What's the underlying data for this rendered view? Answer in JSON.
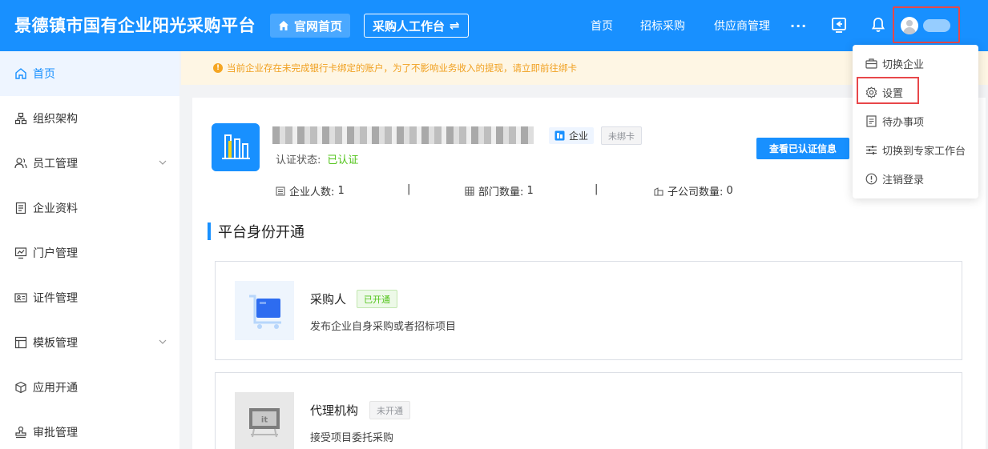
{
  "header": {
    "brand": "景德镇市国有企业阳光采购平台",
    "home_button": "官网首页",
    "workbench_button": "采购人工作台",
    "workbench_swap_glyph": "⇌",
    "nav": {
      "home": "首页",
      "bidding": "招标采购",
      "supplier": "供应商管理",
      "more": "···"
    },
    "icons": [
      "exit-icon",
      "bell-icon",
      "avatar"
    ],
    "colors": {
      "primary": "#1890ff",
      "highlight": "#e8474a"
    }
  },
  "sidebar": {
    "items": [
      {
        "label": "首页",
        "icon": "home-icon",
        "active": true
      },
      {
        "label": "组织架构",
        "icon": "org-chart-icon"
      },
      {
        "label": "员工管理",
        "icon": "users-icon",
        "expandable": true
      },
      {
        "label": "企业资料",
        "icon": "document-icon"
      },
      {
        "label": "门户管理",
        "icon": "monitor-icon"
      },
      {
        "label": "证件管理",
        "icon": "id-card-icon"
      },
      {
        "label": "模板管理",
        "icon": "template-icon",
        "expandable": true
      },
      {
        "label": "应用开通",
        "icon": "cube-icon"
      },
      {
        "label": "审批管理",
        "icon": "stamp-icon"
      }
    ]
  },
  "alert": {
    "text": "当前企业存在未完成银行卡绑定的账户，为了不影响业务收入的提现，请立即前往绑卡",
    "color": "#f0a020"
  },
  "company": {
    "type_tag": "企业",
    "card_tag": "未绑卡",
    "cert_label": "认证状态:",
    "cert_value": "已认证",
    "view_cert_button": "查看已认证信息",
    "stats": {
      "employees_label": "企业人数:",
      "employees_value": "1",
      "departments_label": "部门数量:",
      "departments_value": "1",
      "subsidiaries_label": "子公司数量:",
      "subsidiaries_value": "0",
      "separator": "|"
    }
  },
  "section": {
    "title": "平台身份开通"
  },
  "identities": [
    {
      "name": "采购人",
      "status": "已开通",
      "desc": "发布企业自身采购或者招标项目"
    },
    {
      "name": "代理机构",
      "status": "未开通",
      "desc": "接受项目委托采购"
    }
  ],
  "user_menu": {
    "items": [
      {
        "label": "切换企业",
        "icon": "briefcase-icon"
      },
      {
        "label": "设置",
        "icon": "gear-icon"
      },
      {
        "label": "待办事项",
        "icon": "todo-icon"
      },
      {
        "label": "切换到专家工作台",
        "icon": "sliders-icon"
      },
      {
        "label": "注销登录",
        "icon": "info-circle-icon"
      }
    ]
  }
}
